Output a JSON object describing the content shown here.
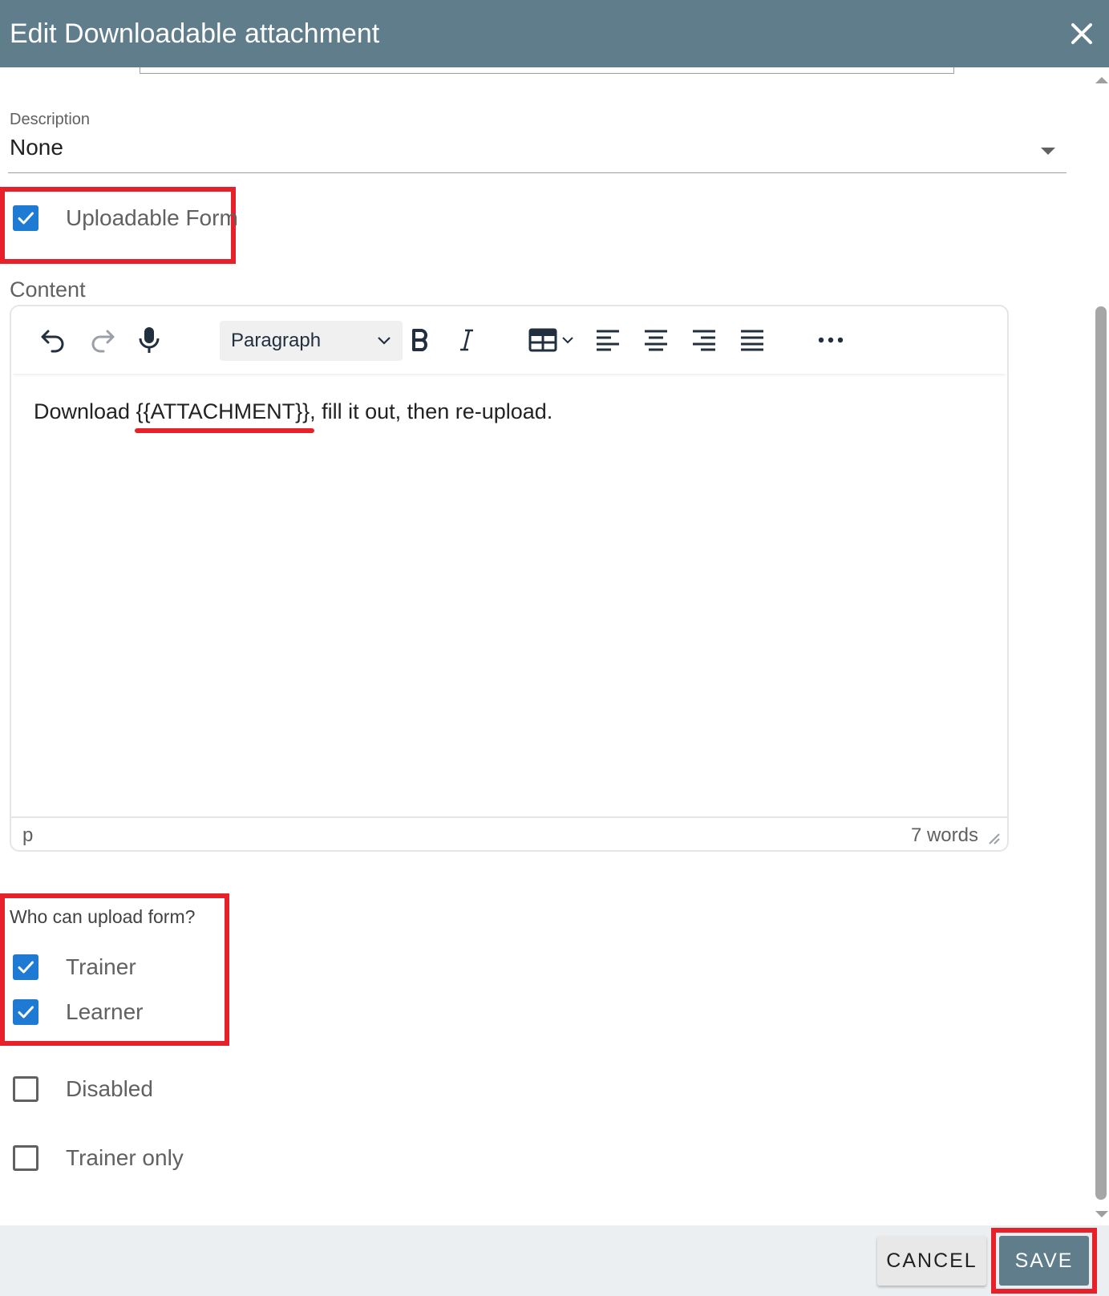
{
  "dialog": {
    "title": "Edit Downloadable attachment"
  },
  "description": {
    "label": "Description",
    "value": "None"
  },
  "uploadable_form": {
    "label": "Uploadable Form",
    "checked": true
  },
  "content": {
    "label": "Content",
    "toolbar": {
      "block_format": "Paragraph"
    },
    "body_text": "Download {{ATTACHMENT}}, fill it out, then re-upload.",
    "status_path": "p",
    "word_count": "7 words"
  },
  "upload_permissions": {
    "label": "Who can upload form?",
    "options": [
      {
        "label": "Trainer",
        "checked": true
      },
      {
        "label": "Learner",
        "checked": true
      }
    ]
  },
  "disabled": {
    "label": "Disabled",
    "checked": false
  },
  "trainer_only": {
    "label": "Trainer only",
    "checked": false
  },
  "footer": {
    "cancel_label": "CANCEL",
    "save_label": "SAVE"
  },
  "colors": {
    "header": "#607d8b",
    "checkbox_checked": "#1e7ad3",
    "highlight": "#e8202a",
    "footer_bg": "#eceff1"
  },
  "icons": {
    "close": "close-icon",
    "undo": "undo-icon",
    "redo": "redo-icon",
    "mic": "microphone-icon",
    "bold": "bold-icon",
    "italic": "italic-icon",
    "table": "table-icon",
    "align_left": "align-left-icon",
    "align_center": "align-center-icon",
    "align_right": "align-right-icon",
    "align_justify": "align-justify-icon",
    "more": "more-icon"
  }
}
